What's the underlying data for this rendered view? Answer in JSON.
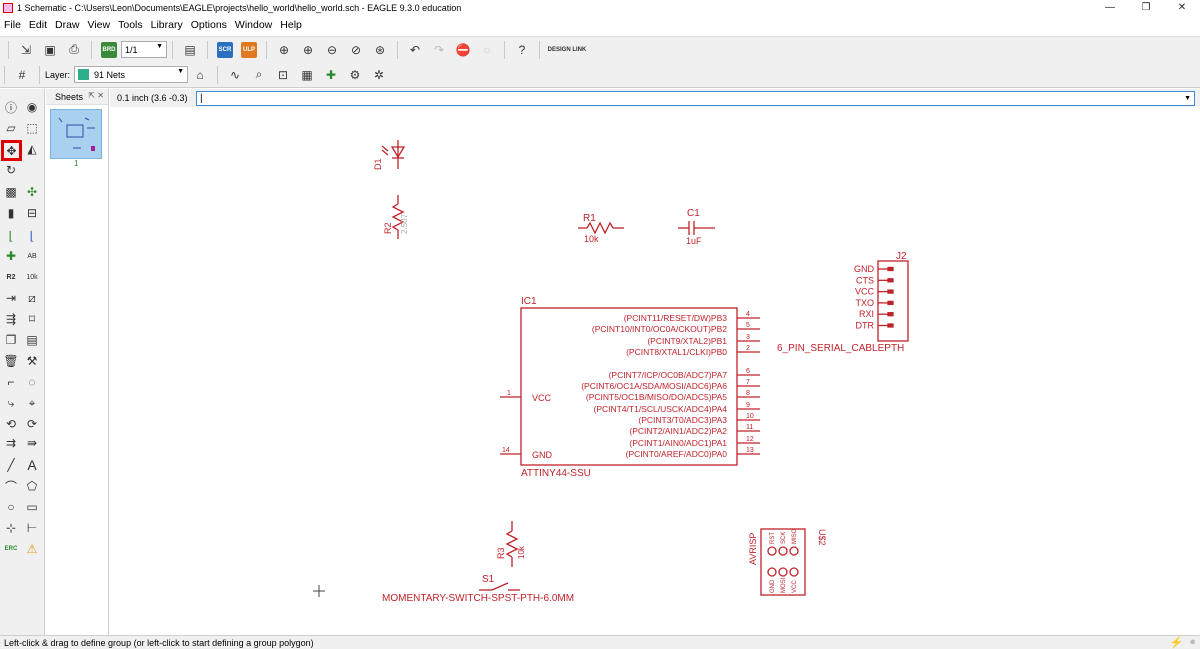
{
  "window": {
    "title": "1 Schematic - C:\\Users\\Leon\\Documents\\EAGLE\\projects\\hello_world\\hello_world.sch - EAGLE 9.3.0 education",
    "minimize": "—",
    "maximize": "❐",
    "close": "✕"
  },
  "menu": [
    "File",
    "Edit",
    "Draw",
    "View",
    "Tools",
    "Library",
    "Options",
    "Window",
    "Help"
  ],
  "toolbar": {
    "sheet_select": "1/1",
    "scr_label": "SCR",
    "ulp_label": "ULP",
    "design_link": "DESIGN LINK",
    "layer_label": "Layer:",
    "layer_value": "91 Nets",
    "layer_color": "#2eae8c"
  },
  "sheets_panel": {
    "title": "Sheets",
    "pin": "⇱ ✕",
    "thumb_label": "1"
  },
  "command": {
    "coordinates": "0.1 inch (3.6 -0.3)",
    "input_value": "|"
  },
  "schematic": {
    "color": "#c0222a",
    "d1": "D1",
    "r2_name": "R2",
    "r2_value": "2.507",
    "r1_name": "R1",
    "r1_value": "10k",
    "c1_name": "C1",
    "c1_value": "1uF",
    "ic1_name": "IC1",
    "ic1_part": "ATTINY44-SSU",
    "ic1_pins_right": [
      {
        "label": "(PCINT11/RESET/DW)PB3",
        "num": "4"
      },
      {
        "label": "(PCINT10/INT0/OC0A/CKOUT)PB2",
        "num": "5"
      },
      {
        "label": "(PCINT9/XTAL2)PB1",
        "num": "3"
      },
      {
        "label": "(PCINT8/XTAL1/CLKI)PB0",
        "num": "2"
      },
      {
        "label": "(PCINT7/ICP/OC0B/ADC7)PA7",
        "num": "6"
      },
      {
        "label": "(PCINT6/OC1A/SDA/MOSI/ADC6)PA6",
        "num": "7"
      },
      {
        "label": "(PCINT5/OC1B/MISO/DO/ADC5)PA5",
        "num": "8"
      },
      {
        "label": "(PCINT4/T1/SCL/USCK/ADC4)PA4",
        "num": "9"
      },
      {
        "label": "(PCINT3/T0/ADC3)PA3",
        "num": "10"
      },
      {
        "label": "(PCINT2/AIN1/ADC2)PA2",
        "num": "11"
      },
      {
        "label": "(PCINT1/AIN0/ADC1)PA1",
        "num": "12"
      },
      {
        "label": "(PCINT0/AREF/ADC0)PA0",
        "num": "13"
      }
    ],
    "ic1_vcc": "VCC",
    "ic1_vcc_num": "1",
    "ic1_gnd": "GND",
    "ic1_gnd_num": "14",
    "j2_name": "J2",
    "j2_part": "6_PIN_SERIAL_CABLEPTH",
    "j2_pins": [
      "GND",
      "CTS",
      "VCC",
      "TXO",
      "RXI",
      "DTR"
    ],
    "r3_name": "R3",
    "r3_value": "10k",
    "s1_name": "S1",
    "s1_part": "MOMENTARY-SWITCH-SPST-PTH-6.0MM",
    "u2_name": "U$2",
    "u2_part": "AVRISP",
    "u2_top_pins": [
      "MISO",
      "SCK",
      "RST"
    ],
    "u2_bottom_pins": [
      "GND",
      "MOSI",
      "VCC"
    ]
  },
  "status": {
    "message": "Left-click & drag to define group (or left-click to start defining a group polygon)",
    "bolt": "⚡",
    "stop": "●"
  }
}
